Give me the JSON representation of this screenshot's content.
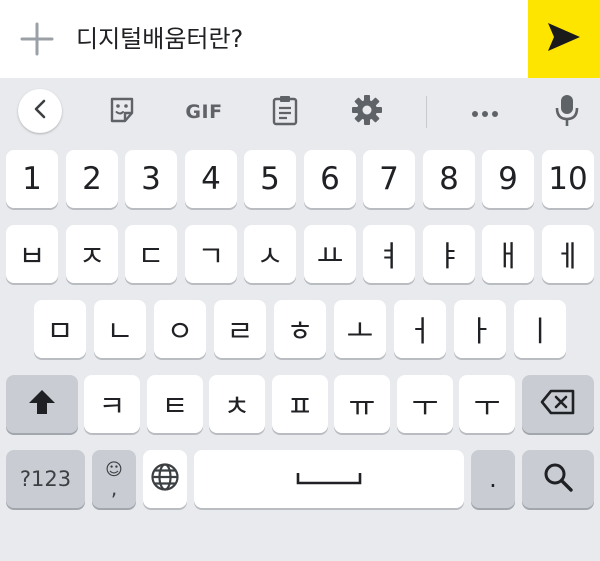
{
  "input_bar": {
    "text": "디지털배움터란?",
    "plus_icon": "plus-icon",
    "send_icon": "send-icon",
    "send_color": "#fee500"
  },
  "toolbar": {
    "back_icon": "chevron-left-icon",
    "sticker_icon": "sticker-icon",
    "gif_label": "GIF",
    "clipboard_icon": "clipboard-icon",
    "settings_icon": "gear-icon",
    "more_icon": "more-horizontal-icon",
    "mic_icon": "microphone-icon"
  },
  "keyboard": {
    "number_row": [
      "1",
      "2",
      "3",
      "4",
      "5",
      "6",
      "7",
      "8",
      "9",
      "10"
    ],
    "row1": [
      "ㅂ",
      "ㅈ",
      "ㄷ",
      "ㄱ",
      "ㅅ",
      "ㅛ",
      "ㅕ",
      "ㅑ",
      "ㅐ",
      "ㅔ"
    ],
    "row2": [
      "ㅁ",
      "ㄴ",
      "ㅇ",
      "ㄹ",
      "ㅎ",
      "ㅗ",
      "ㅓ",
      "ㅏ",
      "ㅣ"
    ],
    "row3": [
      "ㅋ",
      "ㅌ",
      "ㅊ",
      "ㅍ",
      "ㅠ",
      "ㅜ",
      "ㅜ"
    ],
    "shift_icon": "shift-icon",
    "backspace_icon": "backspace-icon",
    "symbols_label": "?123",
    "emoji_comma": {
      "top": "☺",
      "bottom": ","
    },
    "globe_icon": "globe-icon",
    "space_icon": "space-bar-icon",
    "period_label": ".",
    "search_icon": "search-icon"
  }
}
